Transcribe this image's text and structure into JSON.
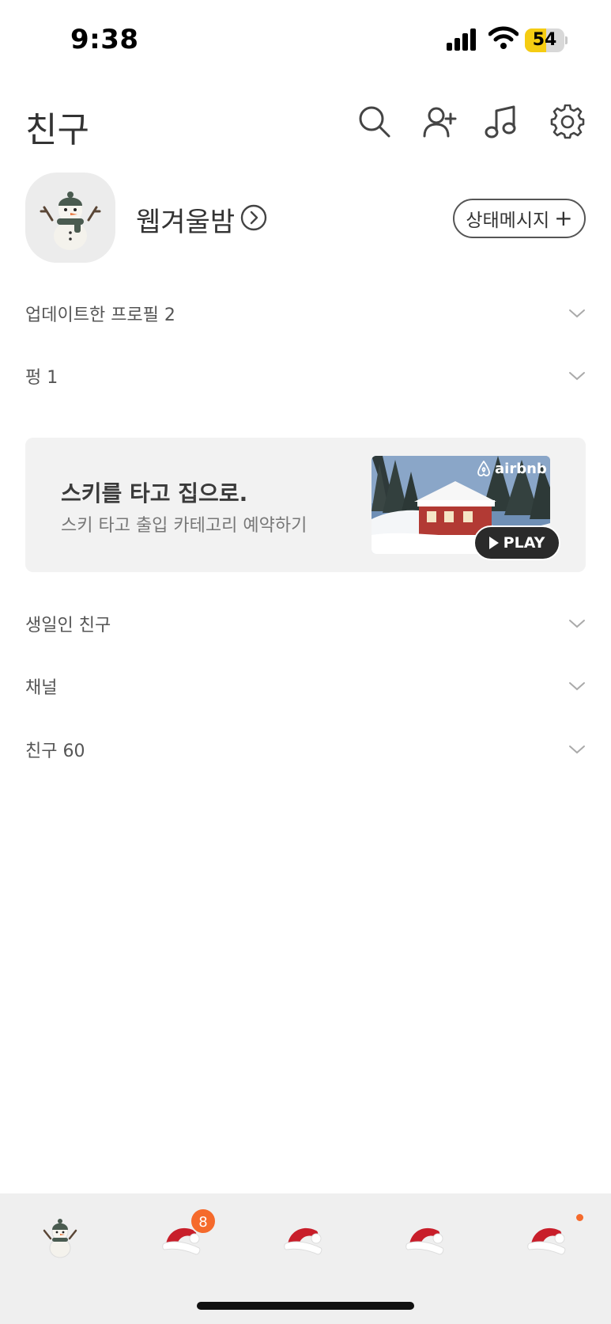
{
  "status_bar": {
    "time": "9:38",
    "battery_level": "54",
    "battery_fraction": 0.54
  },
  "header": {
    "title": "친구",
    "icons": [
      "search-icon",
      "add-friend-icon",
      "music-icon",
      "settings-icon"
    ]
  },
  "profile": {
    "name": "웹겨울밤",
    "status_button_label": "상태메시지",
    "status_button_icon": "+"
  },
  "sections": {
    "updated_profiles": "업데이트한 프로필 2",
    "pyeong": "펑 1",
    "birthday_friends": "생일인 친구",
    "channels": "채널",
    "friends": "친구 60"
  },
  "ad": {
    "title": "스키를 타고 집으로.",
    "subtitle": "스키 타고 출입 카테고리 예약하기",
    "brand": "airbnb",
    "play_label": "PLAY"
  },
  "tab_bar": {
    "chats_badge": "8",
    "items": [
      "friends-tab",
      "chats-tab",
      "view-tab",
      "shopping-tab",
      "more-tab"
    ]
  },
  "colors": {
    "badge": "#f56a2c",
    "battery": "#f5cc12",
    "tab_bar_bg": "#efefef",
    "banner_bg": "#f2f2f2"
  }
}
